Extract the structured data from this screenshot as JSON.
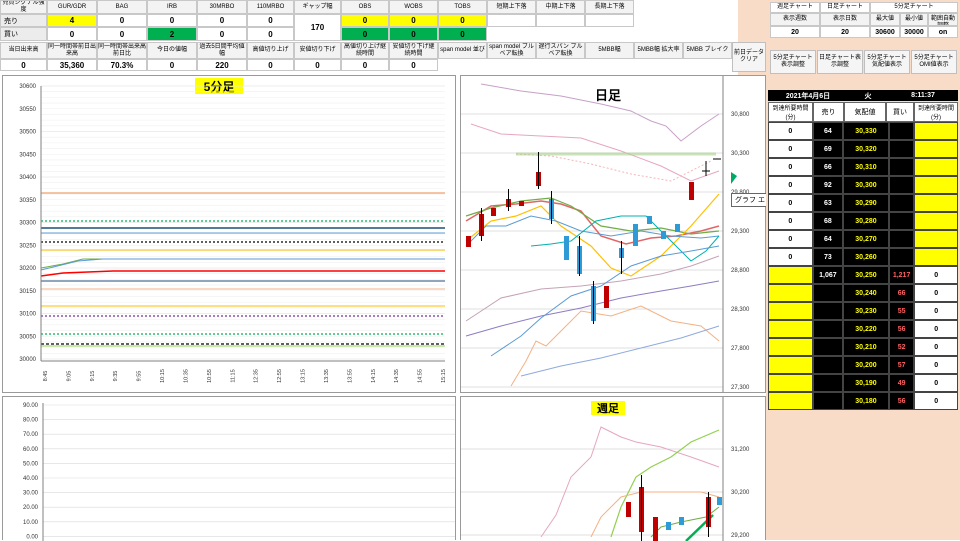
{
  "top_headers_row1": [
    "売買シグナル強度",
    "GUR/GDR",
    "BAG",
    "IRB",
    "30MRBO",
    "110MRBO",
    "ギャップ幅",
    "OBS",
    "WOBS",
    "TOBS",
    "短期上下落",
    "中期上下落",
    "長期上下落"
  ],
  "row_sell": {
    "label": "売り",
    "values": [
      "4",
      "0",
      "0",
      "0",
      "0",
      "0",
      "0",
      "0"
    ]
  },
  "row_buy": {
    "label": "買い",
    "values": [
      "0",
      "0",
      "2",
      "0",
      "0",
      "0",
      "0",
      "0"
    ]
  },
  "gap_value": "170",
  "top_headers_row2": [
    "当日出来高",
    "同一時間帯前日出来高",
    "同一時間帯出来高前日比",
    "今日の値幅",
    "過去5日間平均値幅",
    "高値切り上げ",
    "安値切り下げ",
    "高値切り上げ継続時間",
    "安値切り下げ継続時間",
    "span model 並び",
    "span model ブルベア転換",
    "遅行スパン ブルベア転換",
    "5MBB幅",
    "5MBB幅 拡大率",
    "5MBB ブレイク"
  ],
  "row2_values": [
    "0",
    "35,360",
    "70.3%",
    "0",
    "220",
    "0",
    "0",
    "0",
    "0"
  ],
  "right_panel": {
    "headers": [
      "週足チャート",
      "日足チャート",
      "5分足チャート"
    ],
    "subheaders": [
      "表示週数",
      "表示日数",
      "最大値",
      "最小値",
      "チャート範囲自動調整"
    ],
    "values": [
      "20",
      "20",
      "30600",
      "30000",
      "on"
    ],
    "buttons": [
      "前日データクリア",
      "5分足チャート表示調整",
      "日足チャート表示調整",
      "5分足チャート気配値表示",
      "5分足チャートOMI値表示"
    ]
  },
  "charts": {
    "five_min_title": "5分足",
    "daily_title": "日足",
    "weekly_title": "週足",
    "tooltip": "グラフ エリア",
    "five_min_yticks": [
      "30600",
      "30550",
      "30500",
      "30450",
      "30400",
      "30350",
      "30300",
      "30250",
      "30200",
      "30150",
      "30100",
      "30050",
      "30000"
    ],
    "five_min_xticks": [
      "8:45",
      "9:05",
      "9:15",
      "9:35",
      "9:55",
      "10:15",
      "10:35",
      "10:55",
      "11:15",
      "12:35",
      "12:55",
      "13:15",
      "13:35",
      "13:55",
      "14:15",
      "14:35",
      "14:55",
      "15:15"
    ],
    "lower_yticks": [
      "90.00",
      "80.00",
      "70.00",
      "60.00",
      "50.00",
      "40.00",
      "30.00",
      "20.00",
      "10.00",
      "0.00"
    ],
    "daily_yticks": [
      "30,800",
      "30,300",
      "29,800",
      "29,300",
      "28,800",
      "28,300",
      "27,800",
      "27,300"
    ],
    "weekly_yticks": [
      "31,200",
      "30,200",
      "29,200"
    ]
  },
  "orderbook": {
    "date": "2021年4月6日",
    "weekday": "火",
    "time": "8:11:37",
    "headers": [
      "到達所要時間(分)",
      "売り",
      "気配値",
      "買い",
      "到達所要時間(分)"
    ],
    "sell_rows": [
      {
        "t": "0",
        "sell": "64",
        "price": "30,330"
      },
      {
        "t": "0",
        "sell": "69",
        "price": "30,320"
      },
      {
        "t": "0",
        "sell": "66",
        "price": "30,310"
      },
      {
        "t": "0",
        "sell": "92",
        "price": "30,300"
      },
      {
        "t": "0",
        "sell": "63",
        "price": "30,290"
      },
      {
        "t": "0",
        "sell": "68",
        "price": "30,280"
      },
      {
        "t": "0",
        "sell": "64",
        "price": "30,270"
      },
      {
        "t": "0",
        "sell": "73",
        "price": "30,260"
      }
    ],
    "buy_rows": [
      {
        "sell": "1,067",
        "price": "30,250",
        "buy": "1,217",
        "t": "0"
      },
      {
        "sell": "",
        "price": "30,240",
        "buy": "66",
        "t": "0"
      },
      {
        "sell": "",
        "price": "30,230",
        "buy": "55",
        "t": "0"
      },
      {
        "sell": "",
        "price": "30,220",
        "buy": "56",
        "t": "0"
      },
      {
        "sell": "",
        "price": "30,210",
        "buy": "52",
        "t": "0"
      },
      {
        "sell": "",
        "price": "30,200",
        "buy": "57",
        "t": "0"
      },
      {
        "sell": "",
        "price": "30,190",
        "buy": "49",
        "t": "0"
      },
      {
        "sell": "",
        "price": "30,180",
        "buy": "56",
        "t": "0"
      }
    ]
  }
}
